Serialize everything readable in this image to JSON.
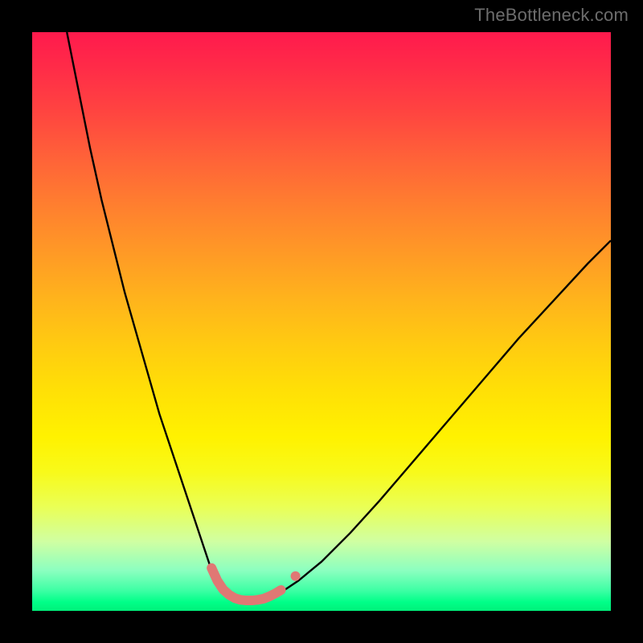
{
  "watermark": "TheBottleneck.com",
  "chart_data": {
    "type": "line",
    "title": "",
    "xlabel": "",
    "ylabel": "",
    "xlim": [
      0,
      100
    ],
    "ylim": [
      0,
      100
    ],
    "grid": false,
    "background_gradient": {
      "top": "#ff1a4d",
      "mid": "#fff200",
      "bottom": "#00f07a"
    },
    "series": [
      {
        "name": "bottleneck-curve",
        "color": "#000000",
        "stroke_width": 2.4,
        "x": [
          6,
          8,
          10,
          12,
          14,
          16,
          18,
          20,
          22,
          24,
          26,
          28,
          30,
          31,
          32,
          33,
          34,
          35,
          36,
          37,
          38,
          39,
          41,
          43,
          46,
          50,
          55,
          60,
          66,
          72,
          78,
          84,
          90,
          96,
          100
        ],
        "values": [
          100,
          90,
          80,
          71,
          63,
          55,
          48,
          41,
          34,
          28,
          22,
          16,
          10,
          7,
          5,
          3.5,
          2.5,
          2,
          1.8,
          1.7,
          1.7,
          1.8,
          2.2,
          3.2,
          5.2,
          8.5,
          13.5,
          19,
          26,
          33,
          40,
          47,
          53.5,
          60,
          64
        ]
      },
      {
        "name": "highlight-segment",
        "color": "#e07874",
        "stroke_width": 12,
        "linecap": "round",
        "x": [
          31,
          32,
          33,
          34,
          35,
          36,
          37,
          38,
          39,
          40,
          41,
          42,
          43
        ],
        "values": [
          7.4,
          5.2,
          3.7,
          2.8,
          2.2,
          1.9,
          1.8,
          1.8,
          1.9,
          2.1,
          2.5,
          3.0,
          3.6
        ]
      },
      {
        "name": "highlight-dot-upper",
        "type_hint": "scatter",
        "color": "#e07874",
        "marker_radius": 6,
        "x": [
          45.5
        ],
        "values": [
          6.0
        ]
      }
    ]
  }
}
